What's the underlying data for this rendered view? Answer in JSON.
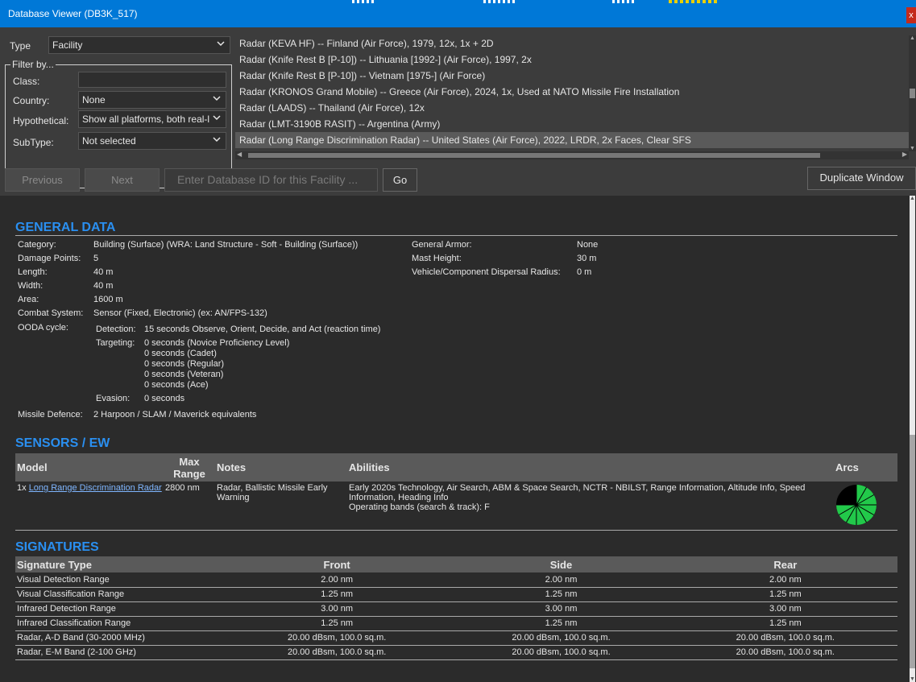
{
  "window": {
    "title": "Database Viewer (DB3K_517)",
    "close_label": "x"
  },
  "header": {
    "type_label": "Type",
    "type_value": "Facility",
    "filter_legend": "Filter by...",
    "class_label": "Class:",
    "class_value": "",
    "country_label": "Country:",
    "country_value": "None",
    "hypothetical_label": "Hypothetical:",
    "hypothetical_value": "Show all platforms, both real-l",
    "subtype_label": "SubType:",
    "subtype_value": "Not selected"
  },
  "list": {
    "items": [
      "Radar (KEVA HF) -- Finland (Air Force), 1979, 12x, 1x + 2D",
      "Radar (Knife Rest B [P-10]) -- Lithuania [1992-] (Air Force), 1997, 2x",
      "Radar (Knife Rest B [P-10]) -- Vietnam [1975-] (Air Force)",
      "Radar (KRONOS Grand Mobile) -- Greece (Air Force), 2024, 1x, Used at NATO Missile Fire Installation",
      "Radar (LAADS) -- Thailand (Air Force), 12x",
      "Radar (LMT-3190B RASIT) -- Argentina (Army)",
      "Radar (Long Range Discrimination Radar) -- United States (Air Force), 2022, LRDR, 2x Faces, Clear SFS"
    ],
    "selected_index": 6
  },
  "nav": {
    "previous_label": "Previous",
    "next_label": "Next",
    "id_placeholder": "Enter Database ID for this Facility ...",
    "go_label": "Go",
    "duplicate_label": "Duplicate Window"
  },
  "general": {
    "title": "GENERAL DATA",
    "category_label": "Category:",
    "category_value": "Building (Surface) (WRA: Land Structure - Soft - Building (Surface))",
    "damage_label": "Damage Points:",
    "damage_value": "5",
    "length_label": "Length:",
    "length_value": "40 m",
    "width_label": "Width:",
    "width_value": "40 m",
    "area_label": "Area:",
    "area_value": "1600 m",
    "combat_label": "Combat System:",
    "combat_value": "Sensor (Fixed, Electronic) (ex: AN/FPS-132)",
    "ooda_label": "OODA cycle:",
    "detection_label": "Detection:",
    "detection_value": "15 seconds Observe, Orient, Decide, and Act (reaction time)",
    "targeting_label": "Targeting:",
    "targeting_values": [
      "0 seconds (Novice Proficiency Level)",
      "0 seconds (Cadet)",
      "0 seconds (Regular)",
      "0 seconds (Veteran)",
      "0 seconds (Ace)"
    ],
    "evasion_label": "Evasion:",
    "evasion_value": "0 seconds",
    "missile_label": "Missile Defence:",
    "missile_value": "2 Harpoon / SLAM / Maverick equivalents",
    "armor_label": "General Armor:",
    "armor_value": "None",
    "mast_label": "Mast Height:",
    "mast_value": "30 m",
    "dispersal_label": "Vehicle/Component Dispersal Radius:",
    "dispersal_value": "0 m"
  },
  "sensors": {
    "title": "SENSORS / EW",
    "headers": {
      "model": "Model",
      "max_range": "Max Range",
      "notes": "Notes",
      "abilities": "Abilities",
      "arcs": "Arcs"
    },
    "rows": [
      {
        "count": "1x",
        "model": "Long Range Discrimination Radar",
        "range": "2800 nm",
        "notes": "Radar, Ballistic Missile Early Warning",
        "abilities": "Early 2020s Technology, Air Search, ABM & Space Search, NCTR - NBILST, Range Information, Altitude Info, Speed Information, Heading Info",
        "bands": "Operating bands (search & track): F"
      }
    ]
  },
  "signatures": {
    "title": "SIGNATURES",
    "headers": {
      "type": "Signature Type",
      "front": "Front",
      "side": "Side",
      "rear": "Rear"
    },
    "rows": [
      {
        "type": "Visual Detection Range",
        "front": "2.00 nm",
        "side": "2.00 nm",
        "rear": "2.00 nm"
      },
      {
        "type": "Visual Classification Range",
        "front": "1.25 nm",
        "side": "1.25 nm",
        "rear": "1.25 nm"
      },
      {
        "type": "Infrared Detection Range",
        "front": "3.00 nm",
        "side": "3.00 nm",
        "rear": "3.00 nm"
      },
      {
        "type": "Infrared Classification Range",
        "front": "1.25 nm",
        "side": "1.25 nm",
        "rear": "1.25 nm"
      },
      {
        "type": "Radar, A-D Band (30-2000 MHz)",
        "front": "20.00 dBsm, 100.0 sq.m.",
        "side": "20.00 dBsm, 100.0 sq.m.",
        "rear": "20.00 dBsm, 100.0 sq.m."
      },
      {
        "type": "Radar, E-M Band (2-100 GHz)",
        "front": "20.00 dBsm, 100.0 sq.m.",
        "side": "20.00 dBsm, 100.0 sq.m.",
        "rear": "20.00 dBsm, 100.0 sq.m."
      }
    ]
  },
  "colors": {
    "accent": "#2a8ff0",
    "titlebar": "#0078d7",
    "arc_green": "#22c94a"
  }
}
